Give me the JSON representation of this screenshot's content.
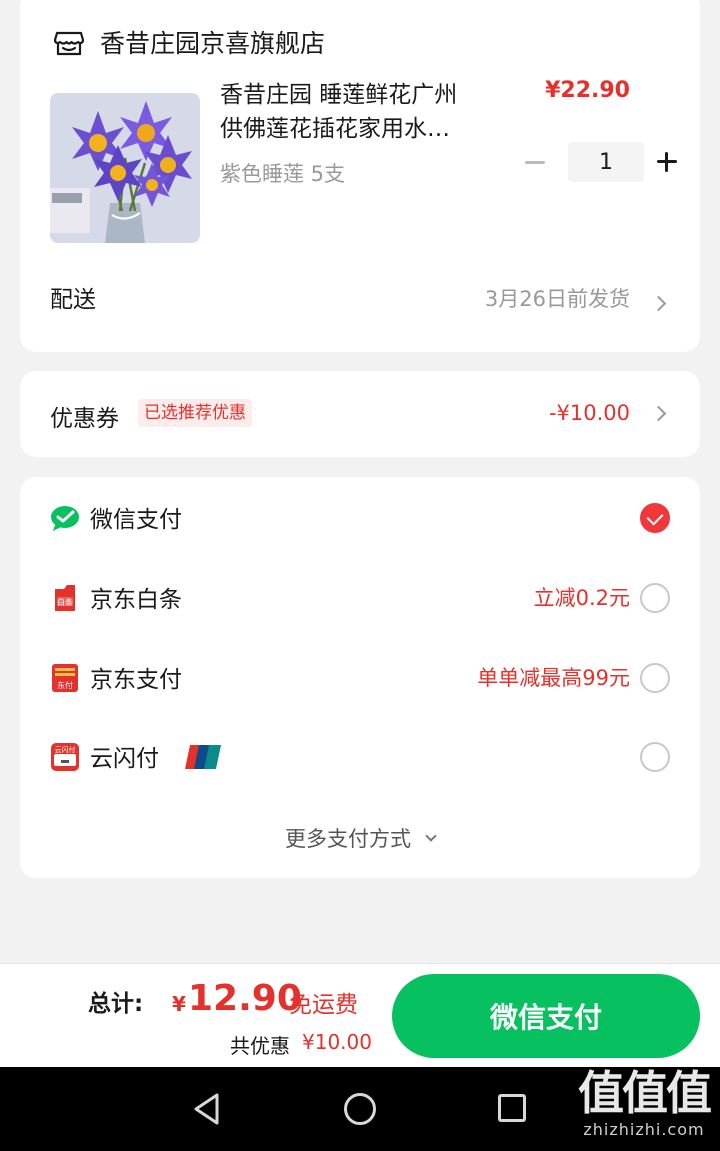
{
  "store": {
    "name": "香昔庄园京喜旗舰店",
    "icon": "store-icon"
  },
  "product": {
    "title_line1": "香昔庄园 睡莲鲜花广州",
    "title_line2": "供佛莲花插花家用水…",
    "variant": "紫色睡莲 5支",
    "price": "¥22.90",
    "quantity": "1"
  },
  "delivery": {
    "label": "配送",
    "value": "3月26日前发货"
  },
  "coupon": {
    "label": "优惠券",
    "tag": "已选推荐优惠",
    "value": "-¥10.00"
  },
  "payment": {
    "methods": [
      {
        "name": "微信支付",
        "promo": "",
        "selected": true,
        "icon": "wechat-pay-icon"
      },
      {
        "name": "京东白条",
        "promo": "立减0.2元",
        "selected": false,
        "icon": "baitiao-icon"
      },
      {
        "name": "京东支付",
        "promo": "单单减最高99元",
        "selected": false,
        "icon": "jd-pay-icon"
      },
      {
        "name": "云闪付",
        "promo": "",
        "selected": false,
        "icon": "yunshanfu-icon"
      }
    ],
    "more": "更多支付方式"
  },
  "bottom": {
    "total_label": "总计:",
    "currency": "¥",
    "total_amount": "12.90",
    "free_shipping": "免运费",
    "saved_label": "共优惠",
    "saved_amount": "¥10.00",
    "pay_button": "微信支付"
  },
  "watermark": {
    "logo": "值值值",
    "site": "zhizhizhi.com"
  },
  "colors": {
    "accent_red": "#e3322b",
    "wechat_green": "#07c160",
    "radio_checked": "#f0373c"
  }
}
